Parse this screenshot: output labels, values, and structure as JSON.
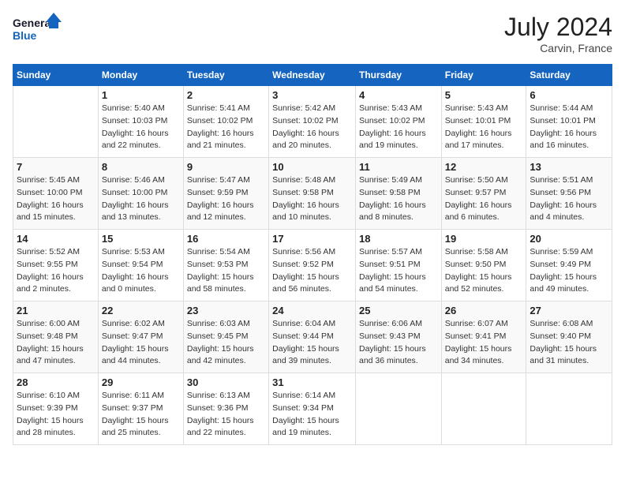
{
  "header": {
    "logo_line1": "General",
    "logo_line2": "Blue",
    "month_year": "July 2024",
    "location": "Carvin, France"
  },
  "weekdays": [
    "Sunday",
    "Monday",
    "Tuesday",
    "Wednesday",
    "Thursday",
    "Friday",
    "Saturday"
  ],
  "weeks": [
    [
      {
        "num": "",
        "detail": ""
      },
      {
        "num": "1",
        "detail": "Sunrise: 5:40 AM\nSunset: 10:03 PM\nDaylight: 16 hours\nand 22 minutes."
      },
      {
        "num": "2",
        "detail": "Sunrise: 5:41 AM\nSunset: 10:02 PM\nDaylight: 16 hours\nand 21 minutes."
      },
      {
        "num": "3",
        "detail": "Sunrise: 5:42 AM\nSunset: 10:02 PM\nDaylight: 16 hours\nand 20 minutes."
      },
      {
        "num": "4",
        "detail": "Sunrise: 5:43 AM\nSunset: 10:02 PM\nDaylight: 16 hours\nand 19 minutes."
      },
      {
        "num": "5",
        "detail": "Sunrise: 5:43 AM\nSunset: 10:01 PM\nDaylight: 16 hours\nand 17 minutes."
      },
      {
        "num": "6",
        "detail": "Sunrise: 5:44 AM\nSunset: 10:01 PM\nDaylight: 16 hours\nand 16 minutes."
      }
    ],
    [
      {
        "num": "7",
        "detail": "Sunrise: 5:45 AM\nSunset: 10:00 PM\nDaylight: 16 hours\nand 15 minutes."
      },
      {
        "num": "8",
        "detail": "Sunrise: 5:46 AM\nSunset: 10:00 PM\nDaylight: 16 hours\nand 13 minutes."
      },
      {
        "num": "9",
        "detail": "Sunrise: 5:47 AM\nSunset: 9:59 PM\nDaylight: 16 hours\nand 12 minutes."
      },
      {
        "num": "10",
        "detail": "Sunrise: 5:48 AM\nSunset: 9:58 PM\nDaylight: 16 hours\nand 10 minutes."
      },
      {
        "num": "11",
        "detail": "Sunrise: 5:49 AM\nSunset: 9:58 PM\nDaylight: 16 hours\nand 8 minutes."
      },
      {
        "num": "12",
        "detail": "Sunrise: 5:50 AM\nSunset: 9:57 PM\nDaylight: 16 hours\nand 6 minutes."
      },
      {
        "num": "13",
        "detail": "Sunrise: 5:51 AM\nSunset: 9:56 PM\nDaylight: 16 hours\nand 4 minutes."
      }
    ],
    [
      {
        "num": "14",
        "detail": "Sunrise: 5:52 AM\nSunset: 9:55 PM\nDaylight: 16 hours\nand 2 minutes."
      },
      {
        "num": "15",
        "detail": "Sunrise: 5:53 AM\nSunset: 9:54 PM\nDaylight: 16 hours\nand 0 minutes."
      },
      {
        "num": "16",
        "detail": "Sunrise: 5:54 AM\nSunset: 9:53 PM\nDaylight: 15 hours\nand 58 minutes."
      },
      {
        "num": "17",
        "detail": "Sunrise: 5:56 AM\nSunset: 9:52 PM\nDaylight: 15 hours\nand 56 minutes."
      },
      {
        "num": "18",
        "detail": "Sunrise: 5:57 AM\nSunset: 9:51 PM\nDaylight: 15 hours\nand 54 minutes."
      },
      {
        "num": "19",
        "detail": "Sunrise: 5:58 AM\nSunset: 9:50 PM\nDaylight: 15 hours\nand 52 minutes."
      },
      {
        "num": "20",
        "detail": "Sunrise: 5:59 AM\nSunset: 9:49 PM\nDaylight: 15 hours\nand 49 minutes."
      }
    ],
    [
      {
        "num": "21",
        "detail": "Sunrise: 6:00 AM\nSunset: 9:48 PM\nDaylight: 15 hours\nand 47 minutes."
      },
      {
        "num": "22",
        "detail": "Sunrise: 6:02 AM\nSunset: 9:47 PM\nDaylight: 15 hours\nand 44 minutes."
      },
      {
        "num": "23",
        "detail": "Sunrise: 6:03 AM\nSunset: 9:45 PM\nDaylight: 15 hours\nand 42 minutes."
      },
      {
        "num": "24",
        "detail": "Sunrise: 6:04 AM\nSunset: 9:44 PM\nDaylight: 15 hours\nand 39 minutes."
      },
      {
        "num": "25",
        "detail": "Sunrise: 6:06 AM\nSunset: 9:43 PM\nDaylight: 15 hours\nand 36 minutes."
      },
      {
        "num": "26",
        "detail": "Sunrise: 6:07 AM\nSunset: 9:41 PM\nDaylight: 15 hours\nand 34 minutes."
      },
      {
        "num": "27",
        "detail": "Sunrise: 6:08 AM\nSunset: 9:40 PM\nDaylight: 15 hours\nand 31 minutes."
      }
    ],
    [
      {
        "num": "28",
        "detail": "Sunrise: 6:10 AM\nSunset: 9:39 PM\nDaylight: 15 hours\nand 28 minutes."
      },
      {
        "num": "29",
        "detail": "Sunrise: 6:11 AM\nSunset: 9:37 PM\nDaylight: 15 hours\nand 25 minutes."
      },
      {
        "num": "30",
        "detail": "Sunrise: 6:13 AM\nSunset: 9:36 PM\nDaylight: 15 hours\nand 22 minutes."
      },
      {
        "num": "31",
        "detail": "Sunrise: 6:14 AM\nSunset: 9:34 PM\nDaylight: 15 hours\nand 19 minutes."
      },
      {
        "num": "",
        "detail": ""
      },
      {
        "num": "",
        "detail": ""
      },
      {
        "num": "",
        "detail": ""
      }
    ]
  ]
}
